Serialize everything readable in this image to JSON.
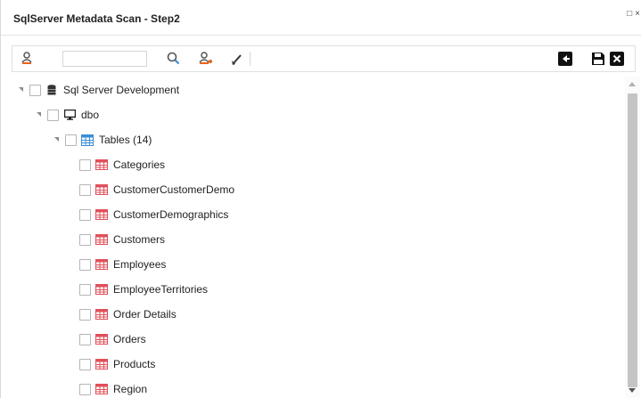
{
  "window": {
    "title": "SqlServer Metadata Scan - Step2",
    "controls": [
      "□",
      "×"
    ]
  },
  "toolbar": {
    "search": {
      "value": "",
      "placeholder": ""
    },
    "icons": [
      "search-person-icon",
      "search-icon",
      "user-search-icon",
      "clear-brush-icon",
      "back-icon",
      "save-icon",
      "close-icon"
    ]
  },
  "tree": {
    "root": {
      "label": "Sql Server Development",
      "icon": "database-icon"
    },
    "schema": {
      "label": "dbo",
      "icon": "monitor-icon"
    },
    "tables_node": {
      "label": "Tables (14)",
      "icon": "tables-grid-icon"
    },
    "tables": [
      {
        "label": "Categories"
      },
      {
        "label": "CustomerCustomerDemo"
      },
      {
        "label": "CustomerDemographics"
      },
      {
        "label": "Customers"
      },
      {
        "label": "Employees"
      },
      {
        "label": "EmployeeTerritories"
      },
      {
        "label": "Order Details"
      },
      {
        "label": "Orders"
      },
      {
        "label": "Products"
      },
      {
        "label": "Region"
      }
    ]
  },
  "colors": {
    "accent_orange": "#e8641b",
    "table_icon_red": "#e0505a",
    "tables_node_blue": "#3a8ed6"
  }
}
